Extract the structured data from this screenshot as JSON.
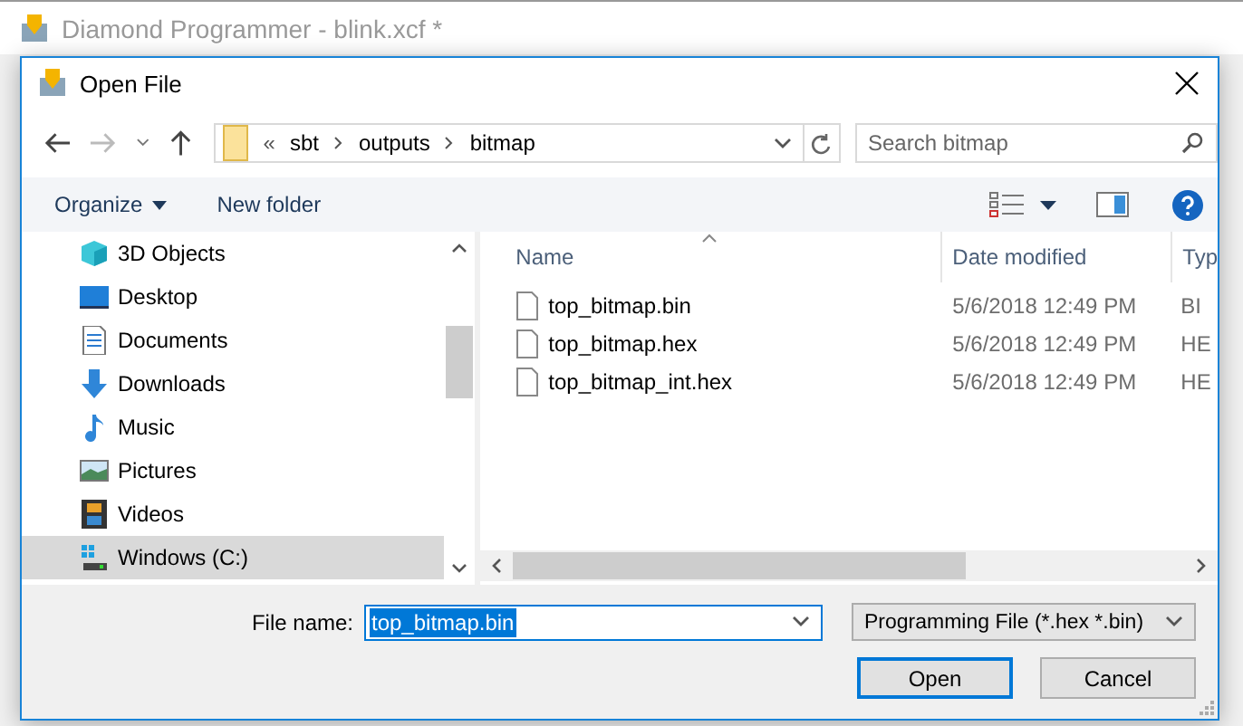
{
  "app_window": {
    "title": "Diamond Programmer - blink.xcf *"
  },
  "dialog": {
    "title": "Open File"
  },
  "address_bar": {
    "overflow": "«",
    "path": [
      "sbt",
      "outputs",
      "bitmap"
    ]
  },
  "search": {
    "placeholder": "Search bitmap"
  },
  "toolbar": {
    "organize": "Organize",
    "new_folder": "New folder"
  },
  "nav_pane": {
    "items": [
      {
        "label": "3D Objects",
        "kind": "objects",
        "selected": false
      },
      {
        "label": "Desktop",
        "kind": "desktop",
        "selected": false
      },
      {
        "label": "Documents",
        "kind": "documents",
        "selected": false
      },
      {
        "label": "Downloads",
        "kind": "downloads",
        "selected": false
      },
      {
        "label": "Music",
        "kind": "music",
        "selected": false
      },
      {
        "label": "Pictures",
        "kind": "pictures",
        "selected": false
      },
      {
        "label": "Videos",
        "kind": "videos",
        "selected": false
      },
      {
        "label": "Windows (C:)",
        "kind": "drive",
        "selected": true
      }
    ]
  },
  "file_list": {
    "columns": [
      "Name",
      "Date modified",
      "Typ"
    ],
    "rows": [
      {
        "name": "top_bitmap.bin",
        "date": "5/6/2018 12:49 PM",
        "type": "BI"
      },
      {
        "name": "top_bitmap.hex",
        "date": "5/6/2018 12:49 PM",
        "type": "HE"
      },
      {
        "name": "top_bitmap_int.hex",
        "date": "5/6/2018 12:49 PM",
        "type": "HE"
      }
    ]
  },
  "file_name": {
    "label": "File name:",
    "value": "top_bitmap.bin",
    "text_selected": true
  },
  "file_type": {
    "value": "Programming File (*.hex *.bin)"
  },
  "buttons": [
    {
      "label": "Open",
      "kind": "primary"
    },
    {
      "label": "Cancel",
      "kind": "normal"
    }
  ]
}
